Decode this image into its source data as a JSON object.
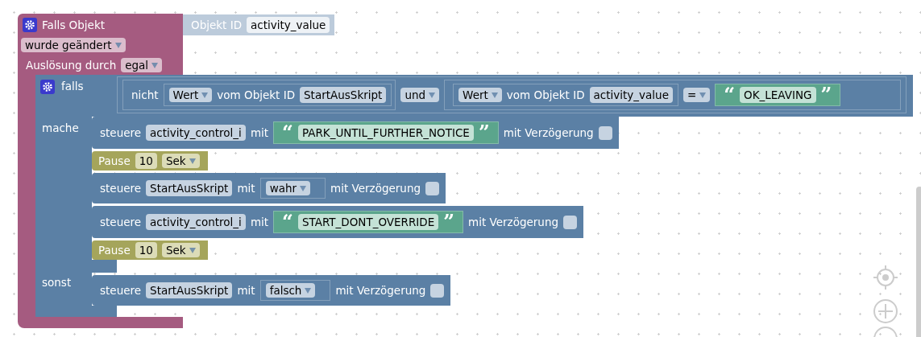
{
  "event": {
    "title": "Falls Objekt",
    "object_label": "Objekt ID",
    "object_id": "activity_value",
    "trigger": "wurde geändert",
    "cause_label": "Auslösung durch",
    "cause": "egal"
  },
  "if_block": {
    "label": "falls",
    "condition": {
      "operator": "und",
      "left": {
        "kind": "not",
        "label": "nicht",
        "inner": {
          "property": "Wert",
          "of_label": "vom Objekt ID",
          "object_id": "StartAusSkript"
        }
      },
      "right": {
        "kind": "compare",
        "inner": {
          "property": "Wert",
          "of_label": "vom Objekt ID",
          "object_id": "activity_value"
        },
        "operator": "=",
        "value": {
          "kind": "text",
          "open": "“",
          "text": "OK_LEAVING",
          "close": "”"
        }
      }
    },
    "then_label": "mache",
    "then": [
      {
        "kind": "control",
        "verb": "steuere",
        "target": "activity_control_i",
        "with": "mit",
        "value": {
          "kind": "text",
          "open": "“",
          "text": "PARK_UNTIL_FURTHER_NOTICE",
          "close": "”"
        },
        "delay_label": "mit Verzögerung",
        "delay": false
      },
      {
        "kind": "pause",
        "label": "Pause",
        "amount": "10",
        "unit": "Sek"
      },
      {
        "kind": "control",
        "verb": "steuere",
        "target": "StartAusSkript",
        "with": "mit",
        "value": {
          "kind": "bool",
          "text": "wahr"
        },
        "delay_label": "mit Verzögerung",
        "delay": false
      },
      {
        "kind": "control",
        "verb": "steuere",
        "target": "activity_control_i",
        "with": "mit",
        "value": {
          "kind": "text",
          "open": "“",
          "text": "START_DONT_OVERRIDE",
          "close": "”"
        },
        "delay_label": "mit Verzögerung",
        "delay": false
      },
      {
        "kind": "pause",
        "label": "Pause",
        "amount": "10",
        "unit": "Sek"
      }
    ],
    "else_label": "sonst",
    "else": [
      {
        "kind": "control",
        "verb": "steuere",
        "target": "StartAusSkript",
        "with": "mit",
        "value": {
          "kind": "bool",
          "text": "falsch"
        },
        "delay_label": "mit Verzögerung",
        "delay": false
      }
    ]
  }
}
